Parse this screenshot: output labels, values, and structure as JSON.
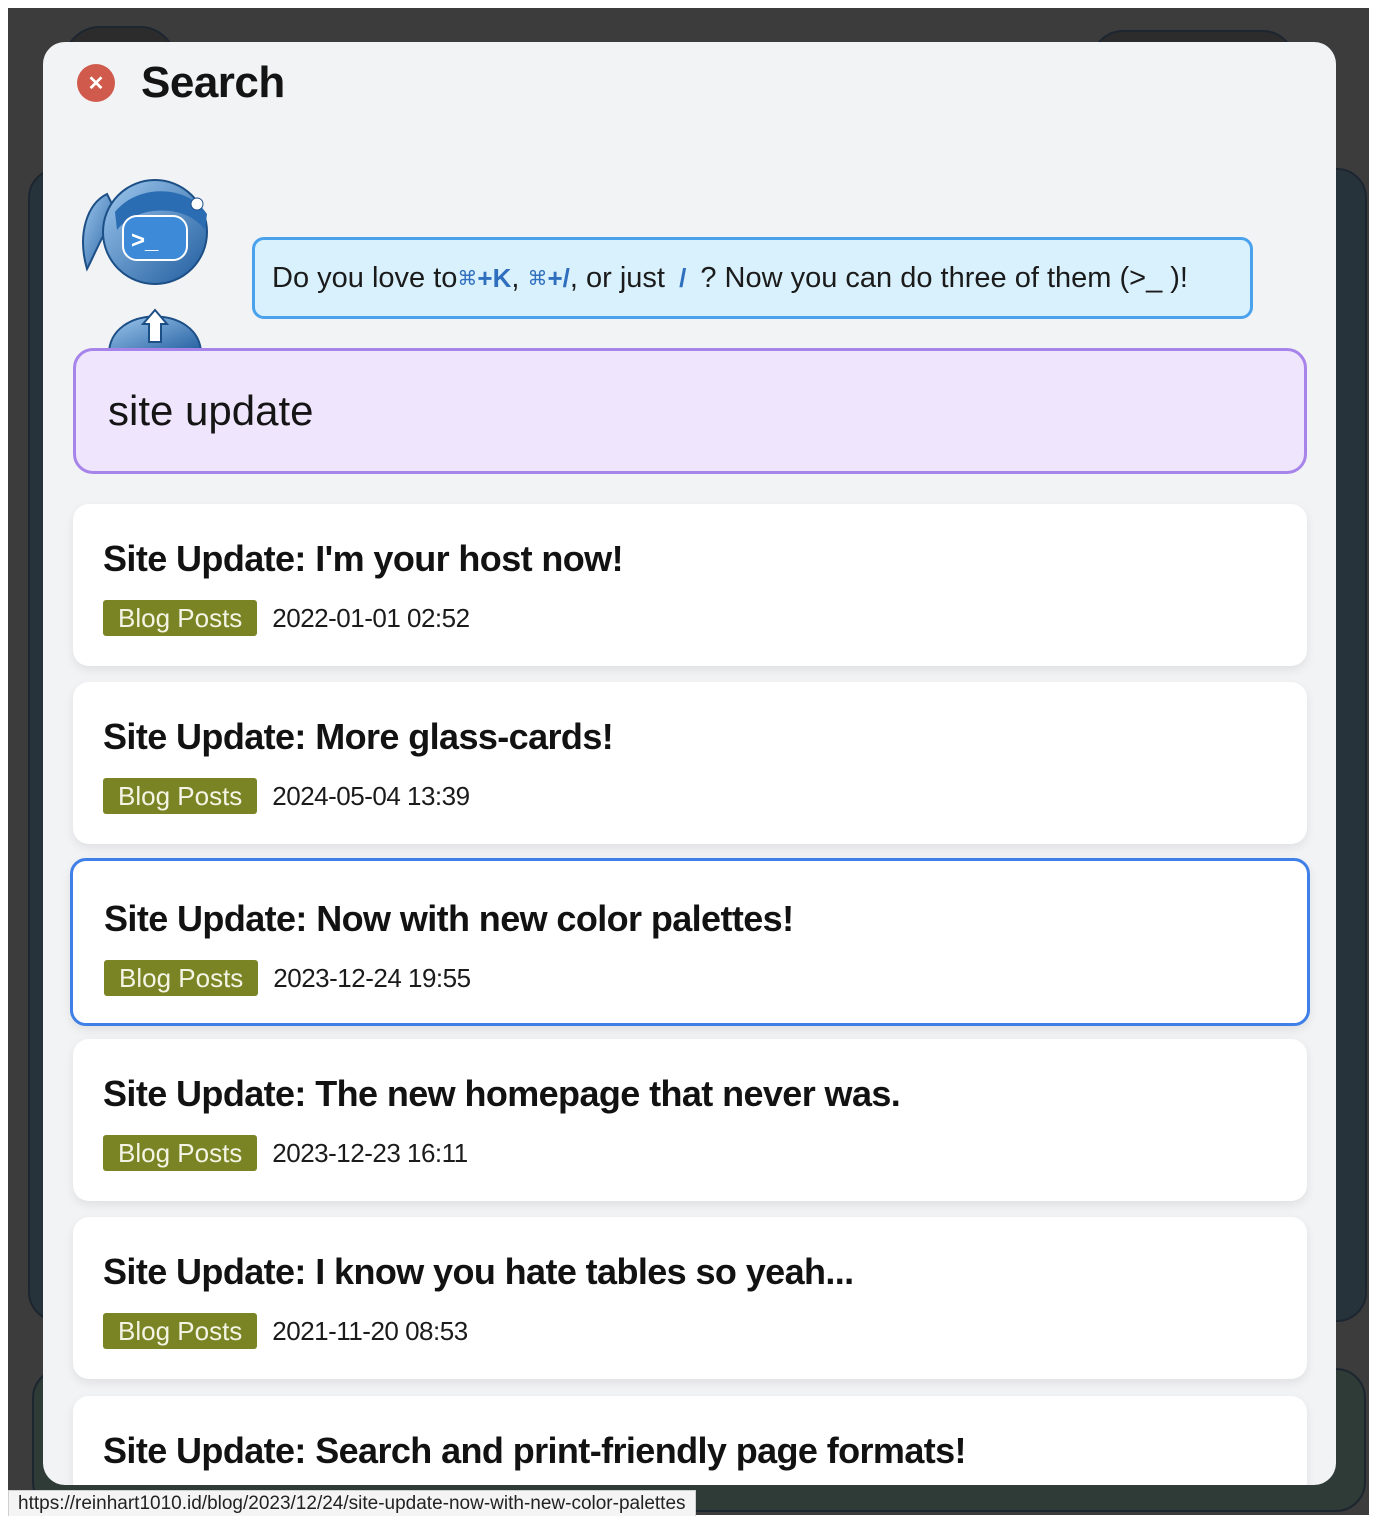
{
  "modal": {
    "title": "Search",
    "close_icon": "close-x-icon"
  },
  "mascot": {
    "icon": "terminal-mascot-icon"
  },
  "hint": {
    "prefix": "Do you love to ",
    "shortcut1_symbol": "⌘",
    "shortcut1_key": "+K",
    "sep1": ", ",
    "shortcut2_symbol": "⌘",
    "shortcut2_key": "+/",
    "sep2": ", or just ",
    "shortcut3": "/",
    "suffix": " ? Now you can do three of them (>_ )!"
  },
  "search": {
    "value": "site update"
  },
  "results": [
    {
      "title": "Site Update: I'm your host now!",
      "tag": "Blog Posts",
      "date": "2022-01-01 02:52"
    },
    {
      "title": "Site Update: More glass-cards!",
      "tag": "Blog Posts",
      "date": "2024-05-04 13:39"
    },
    {
      "title": "Site Update: Now with new color palettes!",
      "tag": "Blog Posts",
      "date": "2023-12-24 19:55"
    },
    {
      "title": "Site Update: The new homepage that never was.",
      "tag": "Blog Posts",
      "date": "2023-12-23 16:11"
    },
    {
      "title": "Site Update: I know you hate tables so yeah...",
      "tag": "Blog Posts",
      "date": "2021-11-20 08:53"
    },
    {
      "title": "Site Update: Search and print-friendly page formats!"
    }
  ],
  "status_url": "https://reinhart1010.id/blog/2023/12/24/site-update-now-with-new-color-palettes",
  "colors": {
    "accent": "#3f7fe8",
    "tag": "#7a8425",
    "input_bg": "#efe5fd",
    "input_border": "#a784ea",
    "bubble_bg": "#d8f1fd",
    "close": "#d05a4c"
  }
}
